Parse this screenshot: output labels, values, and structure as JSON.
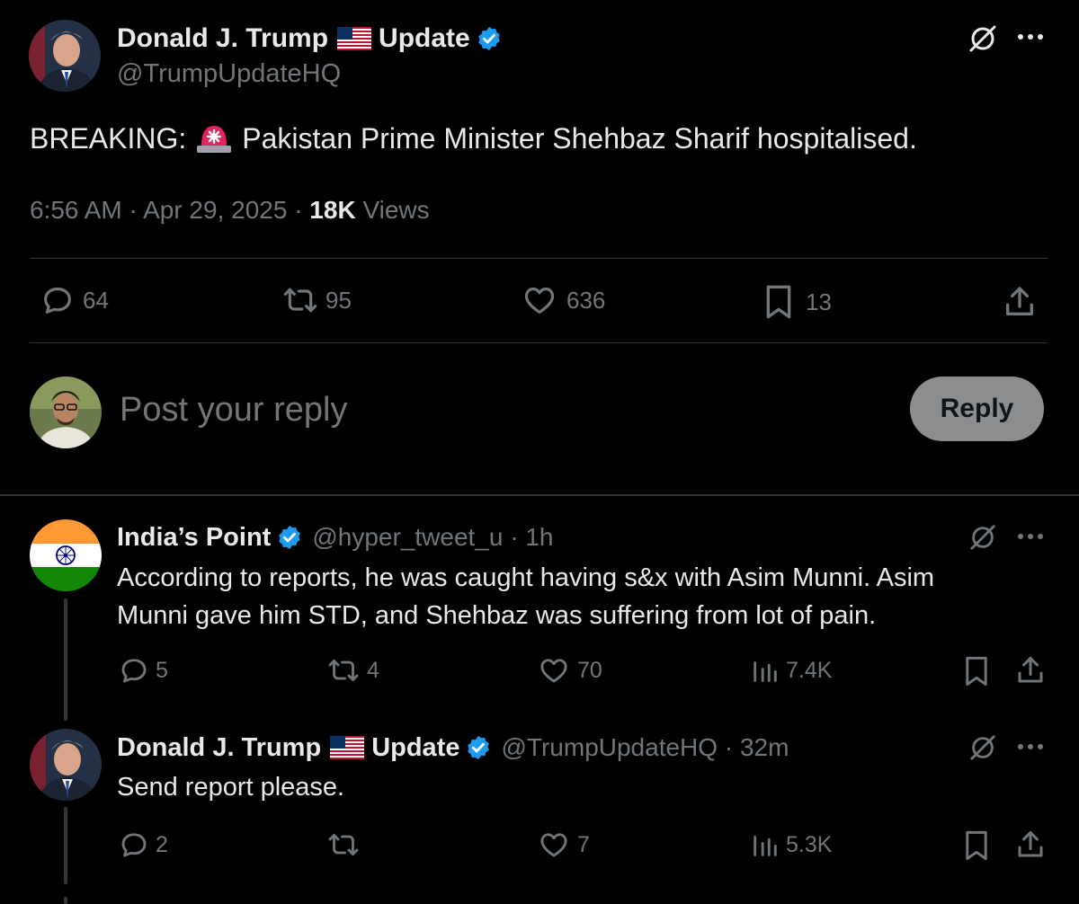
{
  "main_tweet": {
    "display_name": "Donald J. Trump",
    "name_suffix": "Update",
    "handle": "@TrumpUpdateHQ",
    "text_prefix": "BREAKING:",
    "text_body": "Pakistan Prime Minister Shehbaz Sharif hospitalised.",
    "time": "6:56 AM · Apr 29, 2025 · ",
    "views_count": "18K",
    "views_label": " Views",
    "replies": "64",
    "reposts": "95",
    "likes": "636",
    "bookmarks": "13"
  },
  "composer": {
    "placeholder": "Post your reply",
    "reply_label": "Reply"
  },
  "replies": [
    {
      "display_name": "India’s Point",
      "handle_time": "@hyper_tweet_u · 1h",
      "line1": "According to reports, he was caught having s&x with Asim Munni. Asim",
      "line2": "Munni gave him STD, and Shehbaz was suffering from lot of pain.",
      "replies": "5",
      "reposts": "4",
      "likes": "70",
      "views": "7.4K"
    },
    {
      "display_name": "Donald J. Trump",
      "name_suffix": "Update",
      "handle_time": "@TrumpUpdateHQ · 32m",
      "line1": "Send report please.",
      "replies": "2",
      "reposts": "",
      "likes": "7",
      "views": "5.3K"
    }
  ],
  "colors": {
    "background": "#000000",
    "verified": "#1d9bf0",
    "muted": "#71767b",
    "divider": "#2f3336",
    "siren": "#e0245e"
  }
}
